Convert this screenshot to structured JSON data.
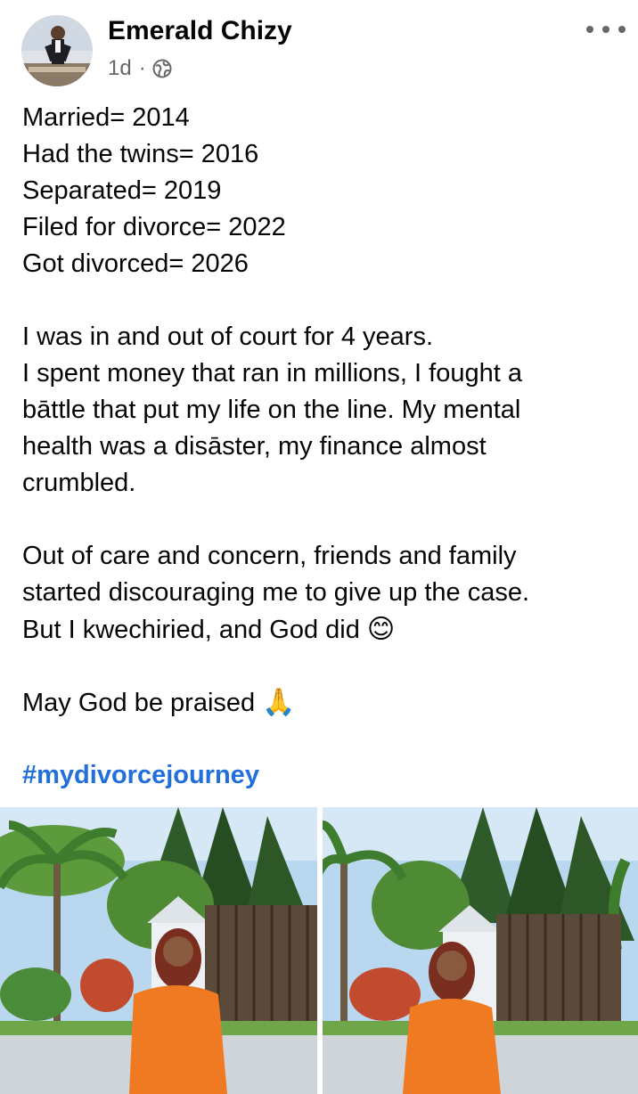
{
  "post": {
    "author": "Emerald Chizy",
    "time": "1d",
    "separator": "·",
    "privacy_icon": "globe-icon",
    "more_icon": "more-options-icon",
    "lines": [
      "Married= 2014",
      "Had the twins= 2016",
      "Separated= 2019",
      "Filed for divorce= 2022",
      "Got divorced= 2026",
      "",
      "I was in and out of court for 4 years.",
      "I spent money that ran in millions, I fought a",
      "bāttle that put my life on the line. My mental",
      "health was a disāster, my finance almost",
      "crumbled.",
      "",
      "Out of care and concern, friends and family",
      "started discouraging me to give up the case.",
      "But I kwechiried, and God did",
      "",
      "May God be praised"
    ],
    "emoji_smile": "😊",
    "emoji_pray": "🙏",
    "hashtag": "#mydivorcejourney"
  },
  "photos": [
    {
      "name": "post-photo-1",
      "subject": "woman in orange dress in front of gate"
    },
    {
      "name": "post-photo-2",
      "subject": "woman in orange dress in front of gate"
    }
  ],
  "colors": {
    "text": "#050505",
    "secondary": "#65676b",
    "hashtag": "#216fdb",
    "orange_dress": "#f07a22"
  }
}
